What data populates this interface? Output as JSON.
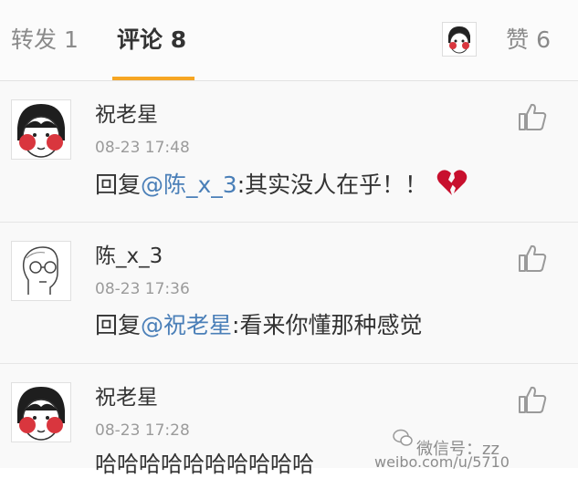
{
  "tabs": {
    "repost": "转发 1",
    "comment": "评论 8",
    "like": "赞 6"
  },
  "comments": [
    {
      "user": "祝老星",
      "time": "08-23 17:48",
      "reply_prefix": "回复",
      "mention": "@陈_x_3",
      "text": ":其实没人在乎！！"
    },
    {
      "user": "陈_x_3",
      "time": "08-23 17:36",
      "reply_prefix": "回复",
      "mention": "@祝老星",
      "text": ":看来你懂那种感觉"
    },
    {
      "user": "祝老星",
      "time": "08-23 17:28",
      "text": "哈哈哈哈哈哈哈哈哈哈"
    }
  ],
  "watermark": {
    "line1": "微信号：zz",
    "line2": "weibo.com/u/5710"
  },
  "colors": {
    "accent": "#f6a623",
    "mention": "#4a7fb8",
    "timestamp": "#9b9b9b"
  }
}
